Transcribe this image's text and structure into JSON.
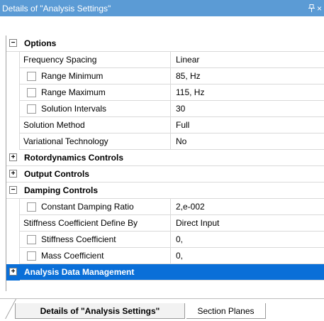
{
  "panel": {
    "title": "Details of \"Analysis Settings\"",
    "pin_icon": "pin-icon",
    "close_icon": "close-icon"
  },
  "colors": {
    "title_bar": "#5b9bd5",
    "selected_row": "#0a6fd8",
    "grid_line": "#d9d9d9"
  },
  "rows": [
    {
      "type": "group",
      "expander": "−",
      "label": "Options"
    },
    {
      "type": "prop",
      "label": "Frequency Spacing",
      "value": "Linear",
      "checkbox": false
    },
    {
      "type": "prop",
      "label": "Range Minimum",
      "value": "85, Hz",
      "checkbox": true
    },
    {
      "type": "prop",
      "label": "Range Maximum",
      "value": "115, Hz",
      "checkbox": true
    },
    {
      "type": "prop",
      "label": "Solution Intervals",
      "value": "30",
      "checkbox": true
    },
    {
      "type": "prop",
      "label": "Solution Method",
      "value": "Full",
      "checkbox": false
    },
    {
      "type": "prop",
      "label": "Variational Technology",
      "value": "No",
      "checkbox": false
    },
    {
      "type": "group",
      "expander": "+",
      "label": "Rotordynamics Controls"
    },
    {
      "type": "group",
      "expander": "+",
      "label": "Output Controls"
    },
    {
      "type": "group",
      "expander": "−",
      "label": "Damping Controls"
    },
    {
      "type": "prop",
      "label": "Constant Damping Ratio",
      "value": "2,e-002",
      "checkbox": true
    },
    {
      "type": "prop",
      "label": "Stiffness Coefficient Define By",
      "value": "Direct Input",
      "checkbox": false
    },
    {
      "type": "prop",
      "label": "Stiffness Coefficient",
      "value": "0,",
      "checkbox": true
    },
    {
      "type": "prop",
      "label": "Mass Coefficient",
      "value": "0,",
      "checkbox": true
    },
    {
      "type": "group",
      "expander": "+",
      "label": "Analysis Data Management",
      "selected": true
    }
  ],
  "tabs": [
    {
      "label": "Details of \"Analysis Settings\"",
      "active": true
    },
    {
      "label": "Section Planes",
      "active": false
    }
  ]
}
